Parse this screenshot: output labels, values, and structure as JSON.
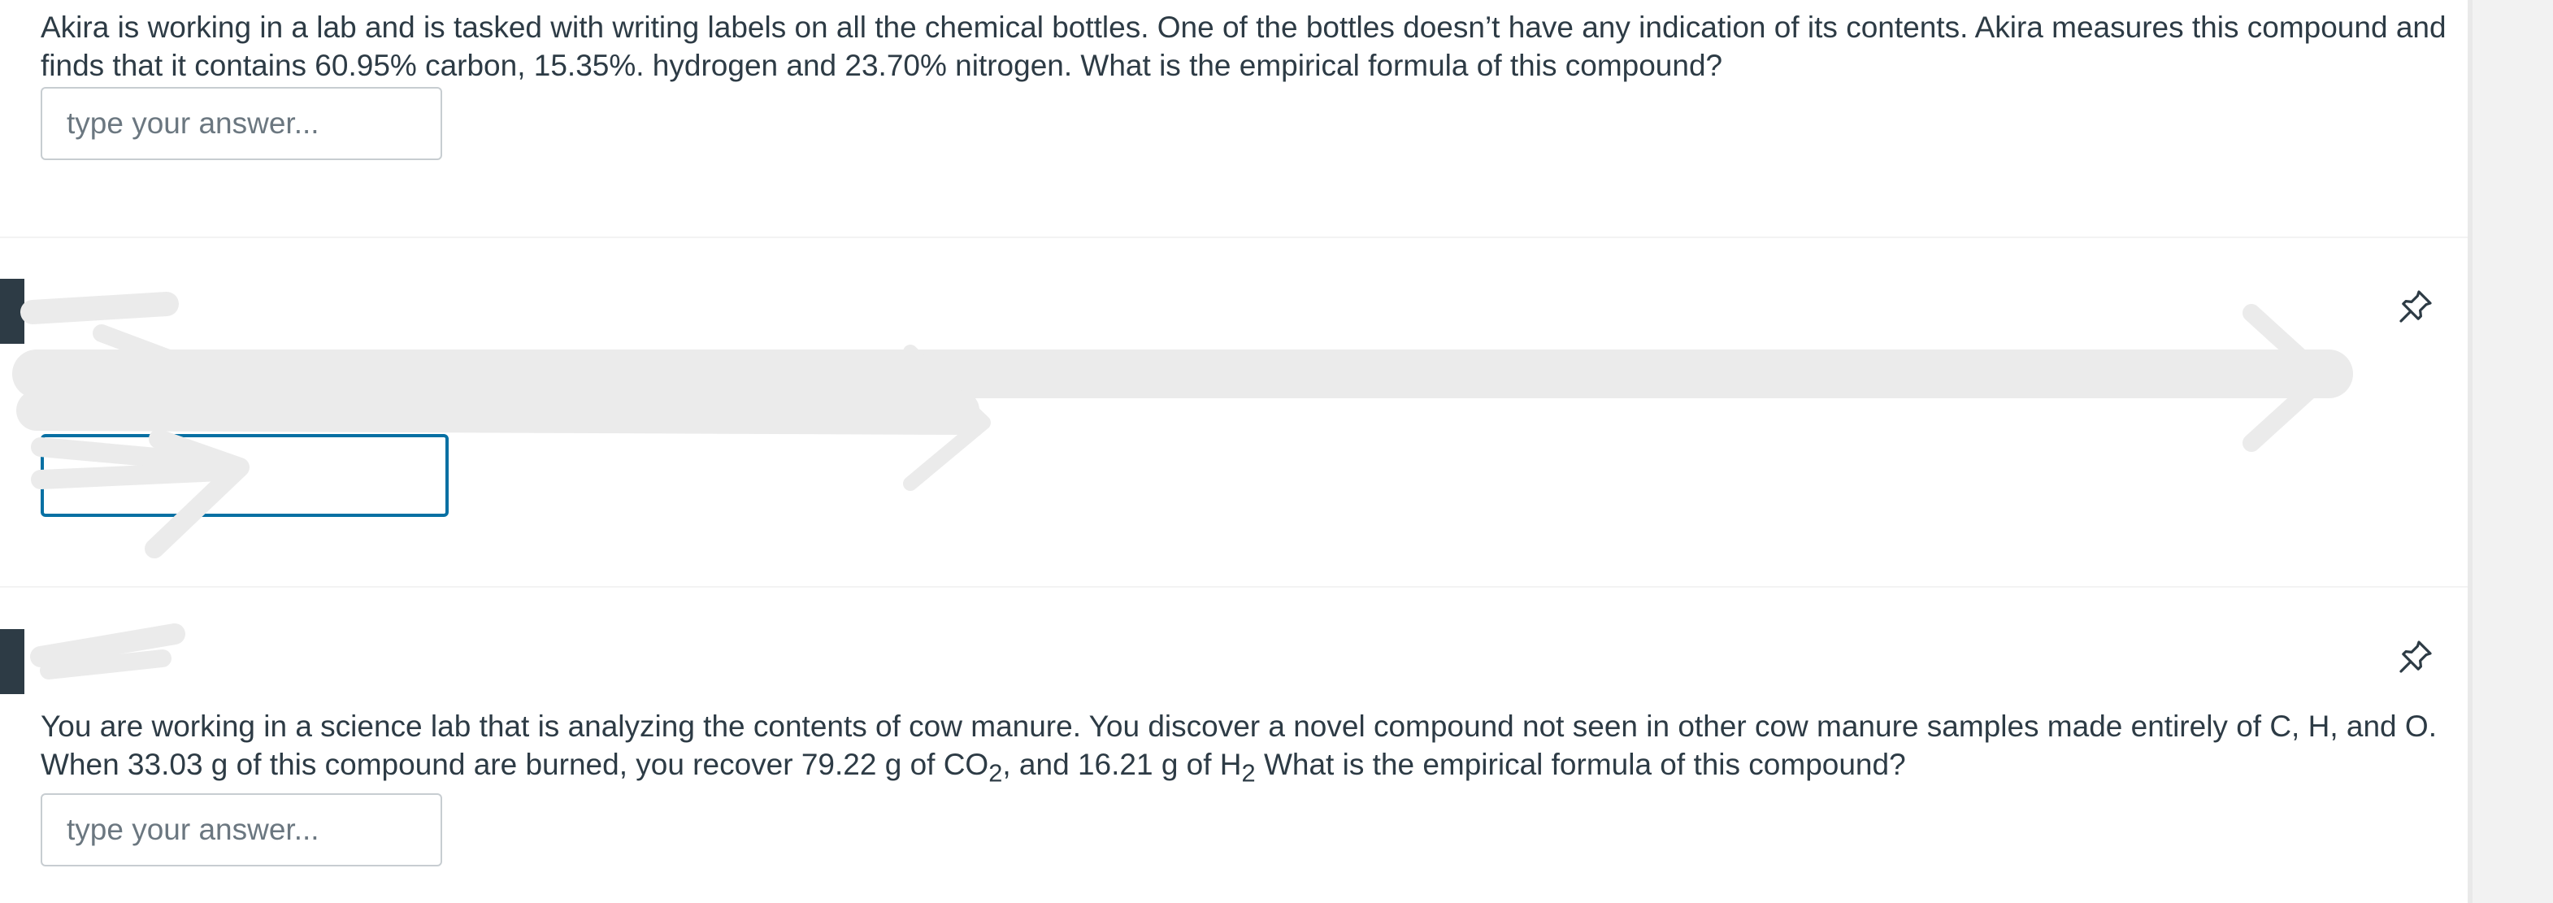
{
  "question1": {
    "text": "Akira is working in a lab and is tasked with writing labels on all the chemical bottles. One of the bottles doesn’t have any indication of its contents. Akira measures this compound and finds that it contains 60.95% carbon, 15.35%. hydrogen and 23.70% nitrogen. What is the empirical formula of this compound?",
    "answer_placeholder": "type your answer..."
  },
  "question2": {
    "answer_value": ""
  },
  "question3": {
    "text_part1": "You are working in a science lab that is analyzing the contents of cow manure. You discover a novel compound not seen in other cow manure samples made entirely of C, H, and O. When 33.03 g of this compound are burned, you recover 79.22 g of CO",
    "sub1": "2",
    "text_part2": ", and 16.21 g of H",
    "sub2": "2",
    "text_part3": " What is the empirical formula of this compound?",
    "answer_placeholder": "type your answer..."
  },
  "icons": {
    "pin": "pushpin-icon",
    "marker": "question-marker"
  },
  "colors": {
    "text": "#2d3b45",
    "focus_border": "#0770a3",
    "input_border": "#c7cdd1",
    "scribble": "#ebebeb"
  }
}
